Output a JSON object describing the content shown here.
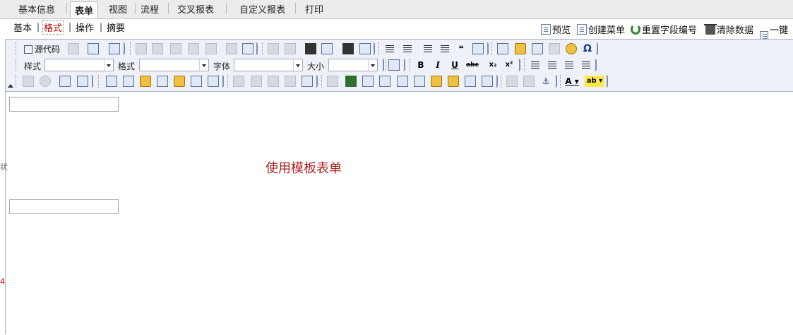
{
  "tabs": [
    {
      "label": "基本信息"
    },
    {
      "label": "表单",
      "active": true
    },
    {
      "label": "视图"
    },
    {
      "label": "流程"
    },
    {
      "label": "交叉报表"
    },
    {
      "label": "自定义报表"
    },
    {
      "label": "打印"
    }
  ],
  "subtabs": [
    {
      "label": "基本"
    },
    {
      "label": "格式",
      "active": true
    },
    {
      "label": "操作"
    },
    {
      "label": "摘要"
    }
  ],
  "subtab_separator": "|",
  "actions": [
    {
      "label": "预览",
      "icon": "preview-icon"
    },
    {
      "label": "创建菜单",
      "icon": "create-menu-icon"
    },
    {
      "label": "重置字段编号",
      "icon": "refresh-icon"
    },
    {
      "label": "清除数据",
      "icon": "trash-icon"
    },
    {
      "label": "一键生",
      "icon": "edit-icon"
    }
  ],
  "toolbar": {
    "source_label": "源代码",
    "style_label": "样式",
    "format_label": "格式",
    "font_label": "字体",
    "size_label": "大小",
    "bold": "B",
    "italic": "I",
    "underline": "U",
    "strike": "abc",
    "subscript": "x₂",
    "superscript": "x²",
    "omega": "Ω",
    "font_color": "A",
    "highlight": "ab"
  },
  "content": {
    "template_text": "使用模板表单"
  },
  "gutter": {
    "mark_top": "状",
    "mark_bottom": "4"
  },
  "colors": {
    "accent_red": "#b02020",
    "toolbar_bg": "#eef1f7",
    "tabbar_bg": "#ececec"
  }
}
